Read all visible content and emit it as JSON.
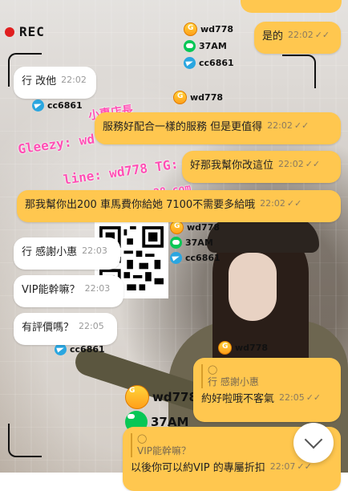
{
  "rec_label": "REC",
  "watermark": {
    "top_right": {
      "gleezy": "wd778",
      "line": "37AM",
      "telegram": "cc6861"
    },
    "left_tg": "cc6861",
    "mid_gleezy": "wd778",
    "pink_line1": "Gleezy: wd",
    "pink_line2": "line: wd778 TG: cc6861",
    "pink_top": "小惠店長",
    "pink_tail": "...28.com",
    "qr_side": {
      "gleezy": "wd778",
      "line": "37AM",
      "telegram": "cc6861"
    },
    "left_tg2": "cc6861",
    "lower_gleezy": "wd778",
    "big_gleezy": "wd778",
    "big_line": "37AM"
  },
  "messages": [
    {
      "dir": "out",
      "text": "是的",
      "time": "22:02",
      "read": "✓✓"
    },
    {
      "dir": "in",
      "text": "行 改他",
      "time": "22:02"
    },
    {
      "dir": "out",
      "text": "服務好配合一樣的服務 但是更值得",
      "time": "22:02",
      "read": "✓✓"
    },
    {
      "dir": "out",
      "text": "好那我幫你改這位",
      "time": "22:02",
      "read": "✓✓"
    },
    {
      "dir": "out",
      "text": "那我幫你出200 車馬費你給她 7100不需要多給哦",
      "time": "22:02",
      "read": "✓✓"
    },
    {
      "dir": "in",
      "text": "行 感謝小惠",
      "time": "22:03"
    },
    {
      "dir": "in",
      "text": "VIP能幹嘛？",
      "time": "22:03"
    },
    {
      "dir": "in",
      "text": "有評價嗎？",
      "time": "22:05"
    },
    {
      "dir": "out",
      "quote_text": "行 感謝小惠",
      "text": "約好啦哦不客氣",
      "time": "22:05",
      "read": "✓✓"
    },
    {
      "dir": "out",
      "quote_text": "VIP能幹嘛？",
      "text": "以後你可以約VIP 的專屬折扣",
      "time": "22:07",
      "read": "✓✓"
    }
  ],
  "icons": {
    "scroll_down": "chevron-down-icon",
    "read_receipt": "double-check-icon"
  },
  "colors": {
    "out_bubble": "#ffc74f",
    "in_bubble": "#ffffff",
    "rec_dot": "#e01f1f",
    "pink_watermark": "#ff4fb4"
  }
}
